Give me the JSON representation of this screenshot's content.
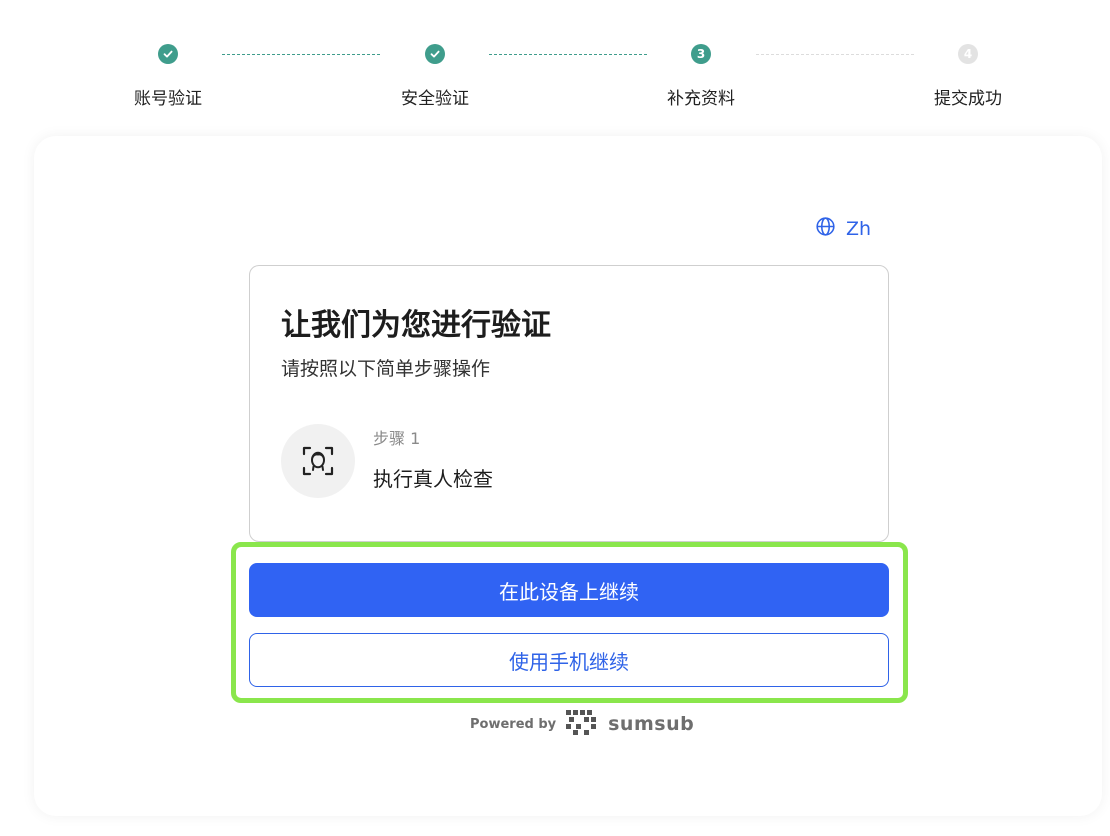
{
  "stepper": {
    "steps": [
      {
        "label": "账号验证",
        "status": "done",
        "number": "1"
      },
      {
        "label": "安全验证",
        "status": "done",
        "number": "2"
      },
      {
        "label": "补充资料",
        "status": "active",
        "number": "3"
      },
      {
        "label": "提交成功",
        "status": "pending",
        "number": "4"
      }
    ]
  },
  "language": {
    "label": "Zh",
    "icon": "globe-icon"
  },
  "card": {
    "title": "让我们为您进行验证",
    "subtitle": "请按照以下简单步骤操作",
    "step": {
      "number_label": "步骤 1",
      "name": "执行真人检查",
      "icon": "face-scan-icon"
    }
  },
  "buttons": {
    "continue_device": "在此设备上继续",
    "continue_phone": "使用手机继续"
  },
  "footer": {
    "powered_by": "Powered by",
    "brand": "sumsub"
  },
  "colors": {
    "accent_blue": "#3063f3",
    "step_green": "#3f9d8c",
    "highlight_green": "#8ae64c"
  }
}
